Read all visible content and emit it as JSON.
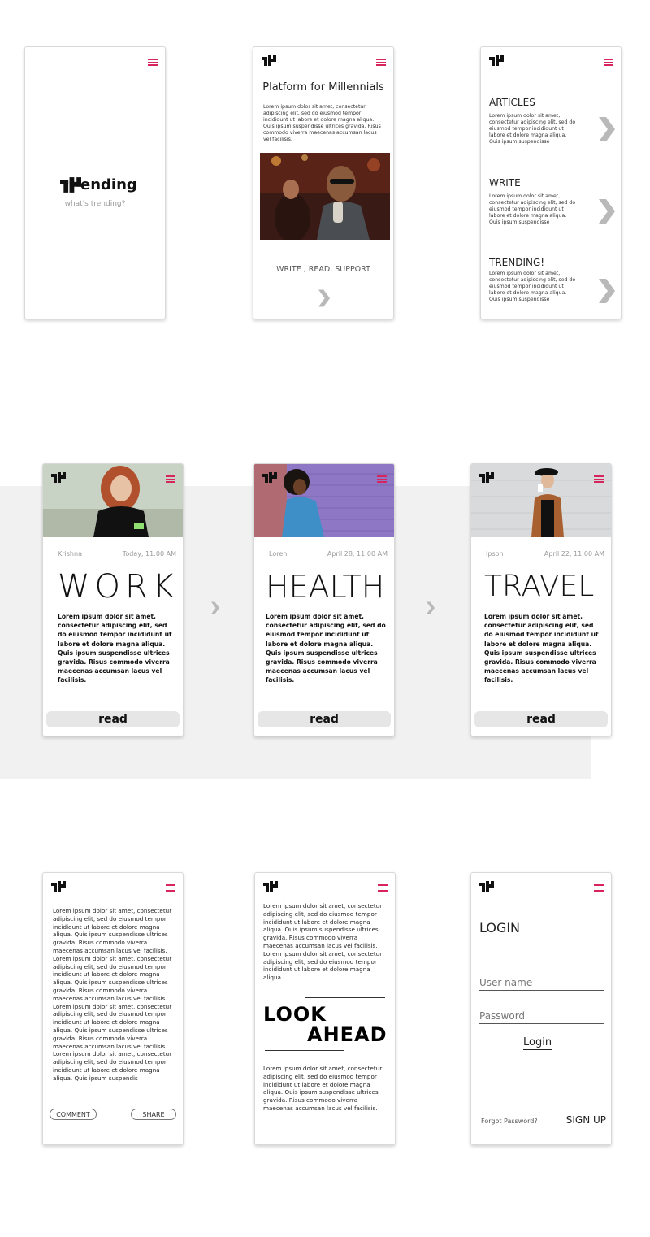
{
  "splash": {
    "logo_word": "ending",
    "tagline": "what's trending?"
  },
  "intro": {
    "title": "Platform for Millennials",
    "paragraph": "Lorem ipsum dolor sit amet, consectetur adipiscing elit, sed do eiusmod tempor incididunt ut labore et dolore magna aliqua. Quis ipsum suspendisse ultrices gravida. Risus commodo viverra maecenas accumsan lacus vel facilisis.",
    "tagline": "WRITE , READ, SUPPORT"
  },
  "sections": {
    "items": [
      {
        "title": "ARTICLES",
        "text": "Lorem ipsum dolor sit amet, consectetur adipiscing elit, sed do eiusmod tempor incididunt ut labore et dolore magna aliqua. Quis ipsum suspendisse"
      },
      {
        "title": "WRITE",
        "text": "Lorem ipsum dolor sit amet, consectetur adipiscing elit, sed do eiusmod tempor incididunt ut labore et dolore magna aliqua. Quis ipsum suspendisse"
      },
      {
        "title": "TRENDING!",
        "text": "Lorem ipsum dolor sit amet, consectetur adipiscing elit, sed do eiusmod tempor incididunt ut labore et dolore magna aliqua. Quis ipsum suspendisse"
      }
    ]
  },
  "articles": [
    {
      "author": "Krishna",
      "date": "Today, 11:00 AM",
      "category": "WORK",
      "body": "Lorem ipsum dolor sit amet, consectetur adipiscing elit, sed do eiusmod tempor incididunt ut labore et dolore magna aliqua. Quis ipsum suspendisse ultrices gravida. Risus commodo viverra maecenas accumsan lacus vel facilisis.",
      "button": "read"
    },
    {
      "author": "Loren",
      "date": "April 28, 11:00 AM",
      "category": "HEALTH",
      "body": "Lorem ipsum dolor sit amet, consectetur adipiscing elit, sed do eiusmod tempor incididunt ut labore et dolore magna aliqua. Quis ipsum suspendisse ultrices gravida. Risus commodo viverra maecenas accumsan lacus vel facilisis.",
      "button": "read"
    },
    {
      "author": "Ipson",
      "date": "April 22, 11:00 AM",
      "category": "TRAVEL",
      "body": "Lorem ipsum dolor sit amet, consectetur adipiscing elit, sed do eiusmod tempor incididunt ut labore et dolore magna aliqua. Quis ipsum suspendisse ultrices gravida. Risus commodo viverra maecenas accumsan lacus vel facilisis.",
      "button": "read"
    }
  ],
  "reading": {
    "text": "Lorem ipsum dolor sit amet, consectetur adipiscing elit, sed do eiusmod tempor incididunt ut labore et dolore magna aliqua. Quis ipsum suspendisse ultrices gravida. Risus commodo viverra maecenas accumsan lacus vel facilisis. Lorem ipsum dolor sit amet, consectetur adipiscing elit, sed do eiusmod tempor incididunt ut labore et dolore magna aliqua. Quis ipsum suspendisse ultrices gravida. Risus commodo viverra maecenas accumsan lacus vel facilisis. Lorem ipsum dolor sit amet, consectetur adipiscing elit, sed do eiusmod tempor incididunt ut labore et dolore magna aliqua. Quis ipsum suspendisse ultrices gravida. Risus commodo viverra maecenas accumsan lacus vel facilisis. Lorem ipsum dolor sit amet, consectetur adipiscing elit, sed do eiusmod tempor incididunt ut labore et dolore magna aliqua. Quis ipsum suspendis",
    "comment": "COMMENT",
    "share": "SHARE"
  },
  "quote": {
    "top": "Lorem ipsum dolor sit amet, consectetur adipiscing elit, sed do eiusmod tempor incididunt ut labore et dolore magna aliqua. Quis ipsum suspendisse ultrices gravida. Risus commodo viverra maecenas accumsan lacus vel facilisis. Lorem ipsum dolor sit amet, consectetur adipiscing elit, sed do eiusmod tempor incididunt ut labore et dolore magna aliqua.",
    "line1": "LOOK",
    "line2": "AHEAD",
    "bottom": "Lorem ipsum dolor sit amet, consectetur adipiscing elit, sed do eiusmod tempor incididunt ut labore et dolore magna aliqua. Quis ipsum suspendisse ultrices gravida. Risus commodo viverra maecenas accumsan lacus vel facilisis."
  },
  "login": {
    "title": "LOGIN",
    "username_placeholder": "User name",
    "password_placeholder": "Password",
    "login_button": "Login",
    "forgot": "Forgot Password?",
    "signup": "SIGN UP"
  },
  "colors": {
    "menu_accent": "#d6245c",
    "arrow_gray": "#b9b9b9",
    "band_gray": "#f1f1f1"
  }
}
